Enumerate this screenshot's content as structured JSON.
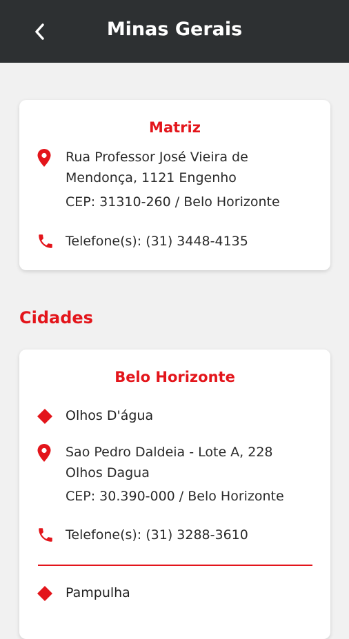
{
  "header": {
    "title": "Minas Gerais",
    "back_icon": "chevron-left-icon"
  },
  "matriz": {
    "title": "Matriz",
    "address_line1": "Rua Professor José Vieira de",
    "address_line2": "Mendonça, 1121 Engenho",
    "cep": "CEP: 31310-260 / Belo Horizonte",
    "phone": "Telefone(s): (31) 3448-4135"
  },
  "cities_section": {
    "title": "Cidades"
  },
  "city_card": {
    "title": "Belo Horizonte",
    "units": [
      {
        "name": "Olhos D'água",
        "address_line1": "Sao Pedro Daldeia - Lote A, 228",
        "address_line2": "Olhos Dagua",
        "cep": "CEP: 30.390-000 / Belo Horizonte",
        "phone": "Telefone(s): (31) 3288-3610"
      },
      {
        "name": "Pampulha"
      }
    ]
  },
  "colors": {
    "accent": "#e3151b",
    "appbar": "#2d3032",
    "background": "#f1f1f1"
  }
}
